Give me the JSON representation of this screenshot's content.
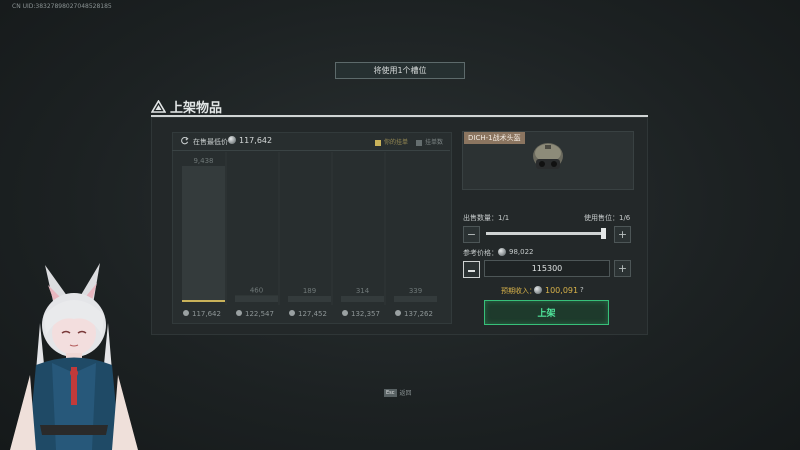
{
  "uid": "CN UID:38327898027048528185",
  "slot_banner": "将使用1个槽位",
  "title": "上架物品",
  "chart_header": {
    "lowest_label": "在售最低价",
    "lowest_value": "117,642",
    "legend_mine": "你的挂单",
    "legend_orders": "挂单数"
  },
  "chart_data": {
    "type": "bar",
    "categories": [
      "117,642",
      "122,547",
      "127,452",
      "132,357",
      "137,262"
    ],
    "values": [
      9438,
      460,
      189,
      314,
      339
    ],
    "value_labels": [
      "9,438",
      "460",
      "189",
      "314",
      "339"
    ],
    "highlight_index": 0,
    "colors": {
      "bar": "#343b3c",
      "highlight": "#c9b25a"
    }
  },
  "item": {
    "name": "DICH-1战术头盔"
  },
  "quantity_label": "出售数量：1/1",
  "slot_label": "使用售位：1/6",
  "quantity_fraction": 1.0,
  "reference_label": "参考价格：",
  "reference_value": "98,022",
  "price_value": "115300",
  "income_label": "预期收入：",
  "income_value": "100,091",
  "help": "?",
  "list_button": "上架",
  "esc": {
    "key": "Esc",
    "label": "返回"
  },
  "colors": {
    "accent": "#37c07a",
    "gold": "#d8b24a"
  }
}
